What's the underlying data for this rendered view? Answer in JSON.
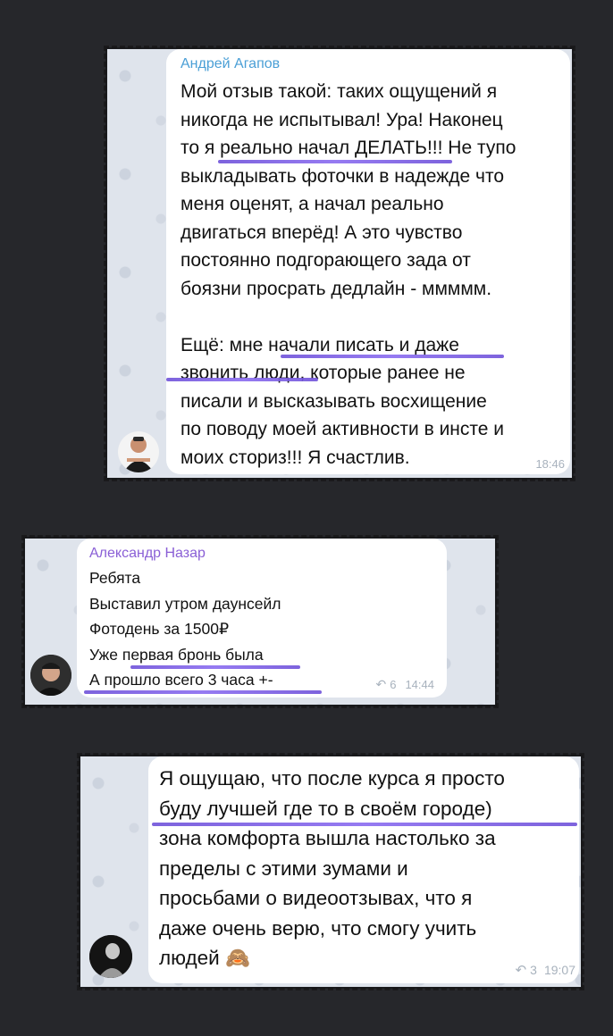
{
  "messages": [
    {
      "sender": "Андрей Агапов",
      "text": "Мой отзыв такой: таких ощущений я\nникогда не испытывал! Ура! Наконец\nто я реально начал ДЕЛАТЬ!!! Не тупо\nвыкладывать фоточки в надежде что\nменя оценят, а начал реально\nдвигаться вперёд! А это чувство\nпостоянно подгорающего зада от\nбоязни просрать дедлайн - ммммм.\n\nЕщё: мне начали писать и даже\nзвонить люди, которые ранее не\nписали и высказывать восхищение\nпо поводу моей активности в инсте и\nмоих сториз!!! Я счастлив.",
      "time": "18:46",
      "sender_color": "#4a9fd6"
    },
    {
      "sender": "Александр Назар",
      "text": "Ребята\nВыставил утром даунсейл\nФотодень за 1500₽\nУже первая бронь была\nА прошло всего 3 часа +-",
      "forwards": "6",
      "time": "14:44",
      "sender_color": "#8a5fd6"
    },
    {
      "text": "Я ощущаю, что после курса я просто\nбуду лучшей где то в своём городе)\nзона комфорта вышла настолько за\nпределы с этими зумами и\nпросьбами о видеоотзывах, что я\nдаже очень верю, что смогу учить\nлюдей 🙈",
      "forwards": "3",
      "time": "19:07"
    }
  ],
  "colors": {
    "highlight": "#7a5ce6",
    "background": "#26272b"
  },
  "icons": {
    "forward": "forward-arrow-icon",
    "emoji": "see-no-evil-monkey"
  }
}
